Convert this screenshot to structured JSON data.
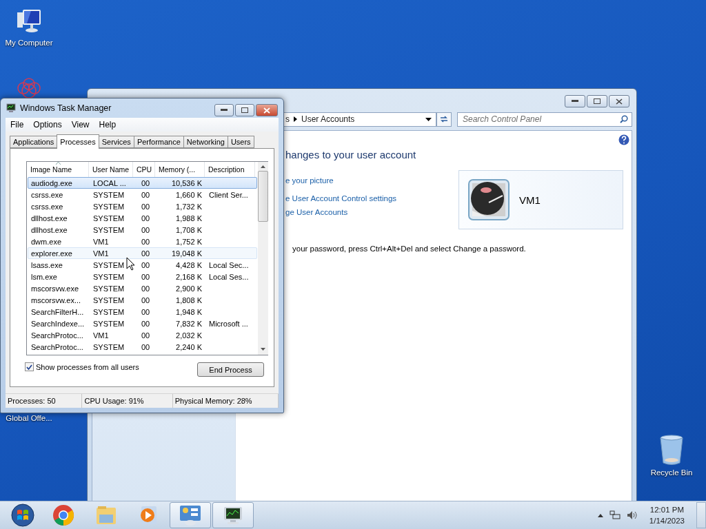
{
  "desktop_icons": [
    {
      "kind": "computer",
      "label": "My Computer"
    },
    {
      "kind": "flower",
      "label": "Global Offe..."
    },
    {
      "kind": "bin",
      "label": "Recycle Bin"
    }
  ],
  "control_panel": {
    "breadcrumb": [
      "s",
      "User Accounts"
    ],
    "search": {
      "placeholder": "Search Control Panel"
    },
    "heading": "hanges to your user account",
    "links": [
      "e your picture",
      "e User Account Control settings",
      "ge User Accounts"
    ],
    "user": {
      "name": "VM1"
    },
    "note": "your password, press Ctrl+Alt+Del and select Change a password."
  },
  "task_manager": {
    "title": "Windows Task Manager",
    "menu": [
      "File",
      "Options",
      "View",
      "Help"
    ],
    "tabs": [
      {
        "label": "Applications",
        "selected": false
      },
      {
        "label": "Processes",
        "selected": true
      },
      {
        "label": "Services",
        "selected": false
      },
      {
        "label": "Performance",
        "selected": false
      },
      {
        "label": "Networking",
        "selected": false
      },
      {
        "label": "Users",
        "selected": false
      }
    ],
    "columns": [
      {
        "label": "Image Name",
        "sorted": true
      },
      {
        "label": "User Name",
        "sorted": false
      },
      {
        "label": "CPU",
        "sorted": false
      },
      {
        "label": "Memory (...",
        "sorted": false
      },
      {
        "label": "Description",
        "sorted": false
      }
    ],
    "rows": [
      {
        "cells": [
          "audiodg.exe",
          "LOCAL ...",
          "00",
          "10,536 K",
          ""
        ],
        "selected": true,
        "hovered": false
      },
      {
        "cells": [
          "csrss.exe",
          "SYSTEM",
          "00",
          "1,660 K",
          "Client Ser..."
        ],
        "selected": false,
        "hovered": false
      },
      {
        "cells": [
          "csrss.exe",
          "SYSTEM",
          "00",
          "1,732 K",
          ""
        ],
        "selected": false,
        "hovered": false
      },
      {
        "cells": [
          "dllhost.exe",
          "SYSTEM",
          "00",
          "1,988 K",
          ""
        ],
        "selected": false,
        "hovered": false
      },
      {
        "cells": [
          "dllhost.exe",
          "SYSTEM",
          "00",
          "1,708 K",
          ""
        ],
        "selected": false,
        "hovered": false
      },
      {
        "cells": [
          "dwm.exe",
          "VM1",
          "00",
          "1,752 K",
          ""
        ],
        "selected": false,
        "hovered": false
      },
      {
        "cells": [
          "explorer.exe",
          "VM1",
          "00",
          "19,048 K",
          ""
        ],
        "selected": false,
        "hovered": true
      },
      {
        "cells": [
          "lsass.exe",
          "SYSTEM",
          "00",
          "4,428 K",
          "Local Sec..."
        ],
        "selected": false,
        "hovered": false
      },
      {
        "cells": [
          "lsm.exe",
          "SYSTEM",
          "00",
          "2,168 K",
          "Local Ses..."
        ],
        "selected": false,
        "hovered": false
      },
      {
        "cells": [
          "mscorsvw.exe",
          "SYSTEM",
          "00",
          "2,900 K",
          ""
        ],
        "selected": false,
        "hovered": false
      },
      {
        "cells": [
          "mscorsvw.ex...",
          "SYSTEM",
          "00",
          "1,808 K",
          ""
        ],
        "selected": false,
        "hovered": false
      },
      {
        "cells": [
          "SearchFilterH...",
          "SYSTEM",
          "00",
          "1,948 K",
          ""
        ],
        "selected": false,
        "hovered": false
      },
      {
        "cells": [
          "SearchIndexe...",
          "SYSTEM",
          "00",
          "7,832 K",
          "Microsoft ..."
        ],
        "selected": false,
        "hovered": false
      },
      {
        "cells": [
          "SearchProtoc...",
          "VM1",
          "00",
          "2,032 K",
          ""
        ],
        "selected": false,
        "hovered": false
      },
      {
        "cells": [
          "SearchProtoc...",
          "SYSTEM",
          "00",
          "2,240 K",
          ""
        ],
        "selected": false,
        "hovered": false
      }
    ],
    "show_all_users": {
      "label": "Show processes from all users",
      "checked": true
    },
    "end_button": "End Process",
    "status": [
      "Processes: 50",
      "CPU Usage: 91%",
      "Physical Memory: 28%"
    ]
  },
  "taskbar": {
    "apps": [
      {
        "kind": "start",
        "active": false
      },
      {
        "kind": "chrome",
        "active": false
      },
      {
        "kind": "explorer",
        "active": false
      },
      {
        "kind": "media",
        "active": false
      },
      {
        "kind": "control-panel",
        "active": true
      },
      {
        "kind": "task-manager",
        "active": true
      }
    ],
    "time": "12:01 PM",
    "date": "1/14/2023"
  }
}
